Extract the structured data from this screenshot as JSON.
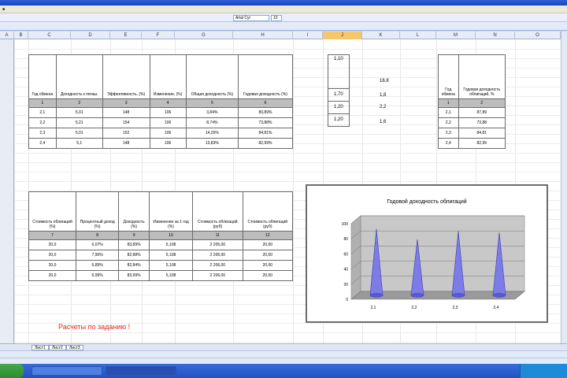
{
  "columns": [
    "A",
    "B",
    "C",
    "D",
    "E",
    "F",
    "G",
    "H",
    "I",
    "J",
    "K",
    "L",
    "M",
    "N",
    "O"
  ],
  "selected_column": "J",
  "table1": {
    "headers": [
      "Год обмена",
      "Доходность к погаш.",
      "Эффективность, (%)",
      "Изменение, (%)",
      "Общая доходность (%)",
      "Годовая доходность (%)"
    ],
    "numbers": [
      "1",
      "2",
      "3",
      "4",
      "5",
      "6"
    ],
    "rows": [
      [
        "2,1",
        "5,01",
        "148",
        "106",
        "3,84%",
        "80,89%"
      ],
      [
        "2,2",
        "5,21",
        "154",
        "106",
        "8,74%",
        "73,88%"
      ],
      [
        "2,3",
        "5,01",
        "152",
        "106",
        "14,26%",
        "84,81%"
      ],
      [
        "2,4",
        "5,1",
        "148",
        "106",
        "13,83%",
        "82,99%"
      ]
    ]
  },
  "side_values": {
    "left": [
      "1,10",
      "1,70",
      "1,20",
      "1,20"
    ],
    "right": [
      "16,8",
      "1,8",
      "2,2",
      "1,6"
    ]
  },
  "table3": {
    "headers": [
      "Год обмена",
      "Годовая доходность облигаций, %"
    ],
    "numbers": [
      "1",
      "2"
    ],
    "rows": [
      [
        "2,1",
        "87,89"
      ],
      [
        "2,2",
        "73,88"
      ],
      [
        "2,3",
        "84,81"
      ],
      [
        "2,4",
        "82,99"
      ]
    ]
  },
  "table2": {
    "headers": [
      "Стоимость облигаций (%)",
      "Процентный доход (%)",
      "Доходность (%)",
      "Изменение за 1 год (%)",
      "Стоимость облигаций (руб)",
      "Стоимость облигаций (руб)"
    ],
    "numbers": [
      "7",
      "8",
      "9",
      "10",
      "11",
      "12"
    ],
    "rows": [
      [
        "20,0",
        "6,07%",
        "83,89%",
        "5,108",
        "2 205,00",
        "20,00"
      ],
      [
        "20,0",
        "7,90%",
        "82,88%",
        "5,108",
        "2 206,00",
        "20,00"
      ],
      [
        "20,0",
        "6,89%",
        "82,84%",
        "5,108",
        "2 206,00",
        "20,00"
      ],
      [
        "20,0",
        "6,99%",
        "83,99%",
        "5,108",
        "2 206,00",
        "20,00"
      ]
    ]
  },
  "note": "Расчеты по заданию !",
  "chart_data": {
    "type": "bar",
    "title": "Годовой доходность облигаций",
    "categories": [
      "2,1",
      "2,2",
      "2,3",
      "2,4"
    ],
    "values": [
      87.89,
      73.88,
      84.81,
      82.99
    ],
    "ylim": [
      0,
      100
    ],
    "yticks": [
      "0",
      "20",
      "40",
      "60",
      "80",
      "100"
    ],
    "bar_color": "#7c7ce6",
    "wall_color": "#c8c8c8",
    "grid": true,
    "legend": "none"
  },
  "sheet_tabs": [
    "Лист1",
    "Лист2",
    "Лист3"
  ],
  "font_box": "Arial Cyr",
  "size_box": "10"
}
